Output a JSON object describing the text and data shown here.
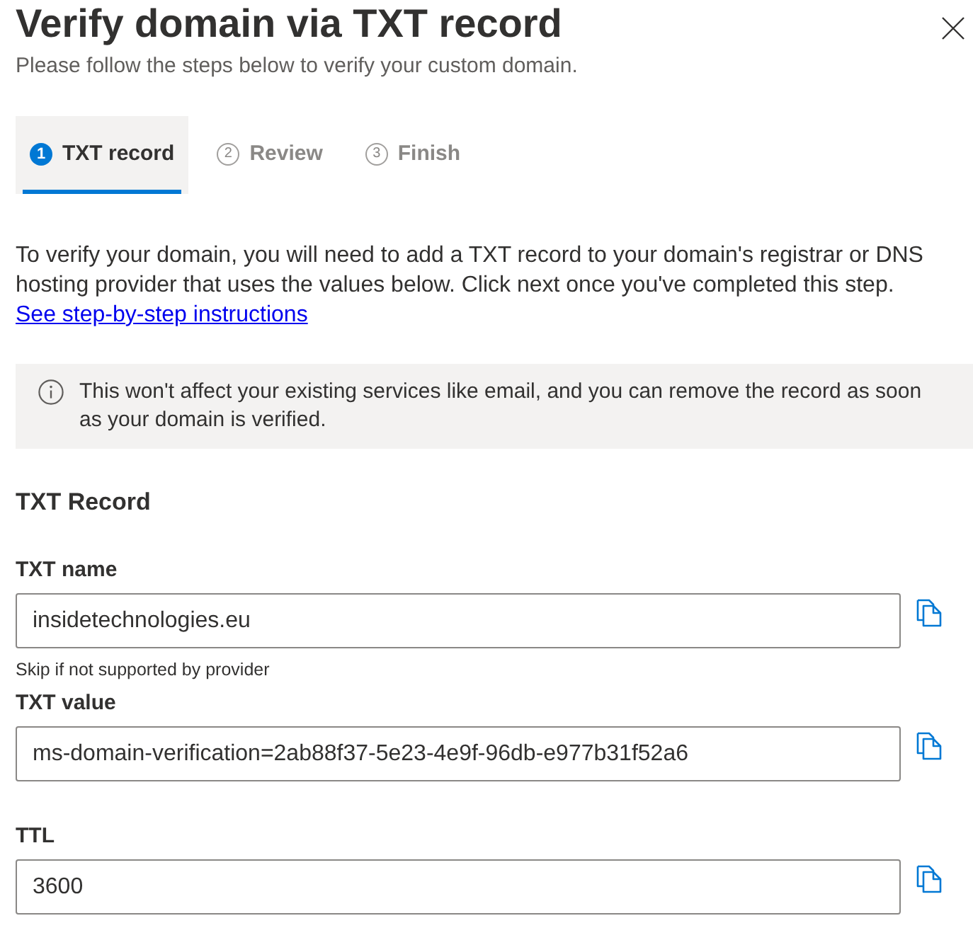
{
  "dialog": {
    "title": "Verify domain via TXT record",
    "subtitle": "Please follow the steps below to verify your custom domain."
  },
  "steps": [
    {
      "number": "1",
      "label": "TXT record",
      "selected": true
    },
    {
      "number": "2",
      "label": "Review",
      "selected": false
    },
    {
      "number": "3",
      "label": "Finish",
      "selected": false
    }
  ],
  "instructions": {
    "text": "To verify your domain, you will need to add a TXT record to your domain's registrar or DNS hosting provider that uses the values below. Click next once you've completed this step.",
    "link": "See step-by-step instructions"
  },
  "info_message": "This won't affect your existing services like email, and you can remove the record as soon as your domain is verified.",
  "section": {
    "title": "TXT Record",
    "fields": [
      {
        "label": "TXT name",
        "value": "insidetechnologies.eu",
        "hint": "Skip if not supported by provider"
      },
      {
        "label": "TXT value",
        "value": "ms-domain-verification=2ab88f37-5e23-4e9f-96db-e977b31f52a6"
      },
      {
        "label": "TTL",
        "value": "3600"
      }
    ]
  }
}
